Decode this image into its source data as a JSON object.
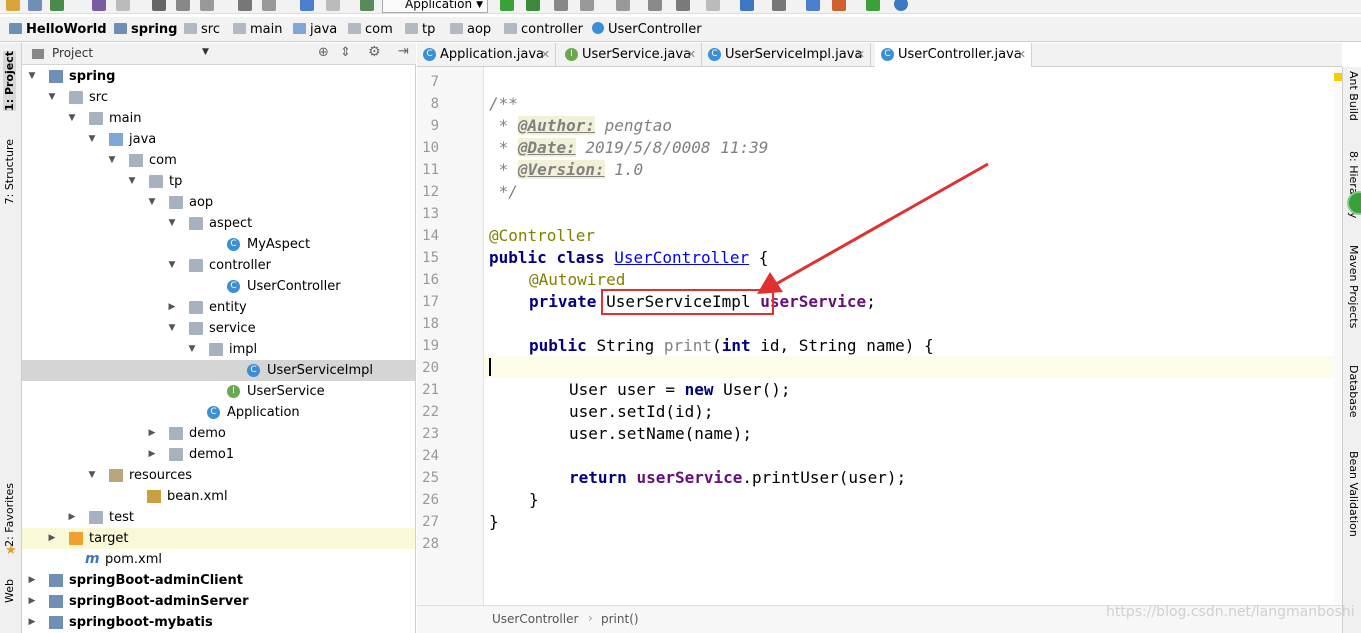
{
  "toolbar": {
    "run_config": "Application"
  },
  "breadcrumbs": [
    "HelloWorld",
    "spring",
    "src",
    "main",
    "java",
    "com",
    "tp",
    "aop",
    "controller",
    "UserController"
  ],
  "left_strip": {
    "project_tab": "1: Project",
    "structure_tab": "7: Structure",
    "favorites_tab": "2: Favorites",
    "web_tab": "Web"
  },
  "project_panel": {
    "title": "Project"
  },
  "tree": [
    {
      "label": "spring",
      "bold": true
    },
    {
      "label": "src"
    },
    {
      "label": "main"
    },
    {
      "label": "java"
    },
    {
      "label": "com"
    },
    {
      "label": "tp"
    },
    {
      "label": "aop"
    },
    {
      "label": "aspect"
    },
    {
      "label": "MyAspect"
    },
    {
      "label": "controller"
    },
    {
      "label": "UserController"
    },
    {
      "label": "entity"
    },
    {
      "label": "service"
    },
    {
      "label": "impl"
    },
    {
      "label": "UserServiceImpl"
    },
    {
      "label": "UserService"
    },
    {
      "label": "Application"
    },
    {
      "label": "demo"
    },
    {
      "label": "demo1"
    },
    {
      "label": "resources"
    },
    {
      "label": "bean.xml"
    },
    {
      "label": "test"
    },
    {
      "label": "target"
    },
    {
      "label": "pom.xml"
    },
    {
      "label": "springBoot-adminClient",
      "bold": true
    },
    {
      "label": "springBoot-adminServer",
      "bold": true
    },
    {
      "label": "springboot-mybatis",
      "bold": true
    }
  ],
  "tabs": [
    {
      "label": "Application.java",
      "icon": "C"
    },
    {
      "label": "UserService.java",
      "icon": "I"
    },
    {
      "label": "UserServiceImpl.java",
      "icon": "C"
    },
    {
      "label": "UserController.java",
      "icon": "C",
      "active": true
    }
  ],
  "editor": {
    "line_numbers": [
      "7",
      "8",
      "9",
      "10",
      "11",
      "12",
      "13",
      "14",
      "15",
      "16",
      "17",
      "18",
      "19",
      "20",
      "21",
      "22",
      "23",
      "24",
      "25",
      "26",
      "27",
      "28"
    ],
    "javadoc": {
      "open": "/**",
      "author_tag": "@Author:",
      "author": " pengtao",
      "date_tag": "@Date:",
      "date": " 2019/5/8/0008 11:39",
      "version_tag": "@Version:",
      "version": " 1.0",
      "close": " */",
      "star": " * "
    },
    "ann_controller": "@Controller",
    "kw_public": "public",
    "kw_class": "class",
    "class_name": "UserController",
    "brace_open": " {",
    "ann_autowired": "@Autowired",
    "kw_private": "private",
    "field_type": "UserServiceImpl",
    "field_name": "userService",
    "semicolon": ";",
    "method_ret": "String",
    "method_name": "print",
    "kw_int": "int",
    "params_a": "(",
    "params_b": " id, String name) {",
    "line21_a": "User user = ",
    "kw_new": "new",
    "line21_b": " User();",
    "line22": "user.setId(id);",
    "line23": "user.setName(name);",
    "kw_return": "return",
    "line25_field": "userService",
    "line25_rest": ".printUser(user);",
    "close_method": "}",
    "close_class": "}"
  },
  "status": {
    "crumb1": "UserController",
    "crumb2": "print()"
  },
  "right_strip": {
    "ant": "Ant Build",
    "hier": "8: Hierarchy",
    "maven": "Maven Projects",
    "db": "Database",
    "bean": "Bean Validation"
  },
  "watermark": "https://blog.csdn.net/langmanboshi",
  "colors": {
    "highlight_box": "#e03030",
    "arrow": "#e03030"
  }
}
